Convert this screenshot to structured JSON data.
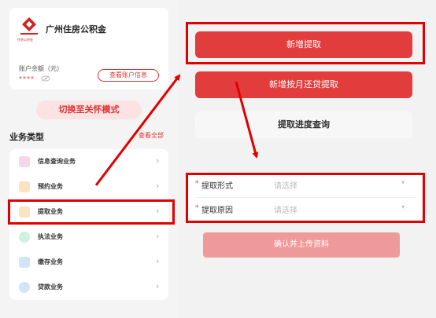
{
  "account": {
    "fund_name": "广州住房公积金",
    "logo_text": "住房公积金",
    "balance_label": "账户余额（元）",
    "balance_mask": "****",
    "view_account_label": "查看账户信息"
  },
  "care_mode_label": "切换至关怀模式",
  "business": {
    "title": "业务类型",
    "view_all_label": "查看全部",
    "items": [
      {
        "label": "信息查询业务",
        "icon": "info-query-icon",
        "color": "#e06fae"
      },
      {
        "label": "预约业务",
        "icon": "appointment-icon",
        "color": "#f0a23a"
      },
      {
        "label": "提取业务",
        "icon": "withdraw-icon",
        "color": "#f0a23a"
      },
      {
        "label": "执法业务",
        "icon": "enforcement-icon",
        "color": "#2bbf8a"
      },
      {
        "label": "缴存业务",
        "icon": "deposit-icon",
        "color": "#3a8fe0"
      },
      {
        "label": "贷款业务",
        "icon": "loan-icon",
        "color": "#3a8fe0"
      }
    ]
  },
  "right": {
    "new_withdraw_label": "新增提取",
    "monthly_repay_label": "新增按月还贷提取",
    "progress_query_label": "提取进度查询",
    "form": {
      "required_mark": "*",
      "method_label": "提取形式",
      "method_placeholder": "请选择",
      "reason_label": "提取原因",
      "reason_placeholder": "请选择",
      "caret": "▾"
    },
    "confirm_upload_label": "确认并上传资料"
  },
  "colors": {
    "brand_red": "#e23c3c",
    "highlight_red": "#e10000",
    "disabled_red": "#ef9a9a"
  }
}
